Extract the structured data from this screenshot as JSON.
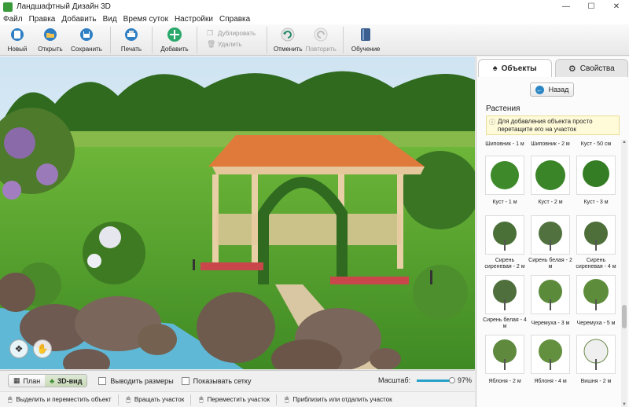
{
  "window": {
    "title": "Ландшафтный Дизайн 3D",
    "min": "—",
    "max": "☐",
    "close": "✕"
  },
  "menu": [
    "Файл",
    "Правка",
    "Добавить",
    "Вид",
    "Время суток",
    "Настройки",
    "Справка"
  ],
  "toolbar": {
    "new": "Новый",
    "open": "Открыть",
    "save": "Сохранить",
    "print": "Печать",
    "add": "Добавить",
    "duplicate": "Дублировать",
    "delete": "Удалить",
    "undo": "Отменить",
    "redo": "Повторить",
    "tutorial": "Обучение"
  },
  "panel": {
    "tab_objects": "Объекты",
    "tab_properties": "Свойства",
    "back": "Назад",
    "section": "Растения",
    "hint": "Для добавления объекта просто перетащите его на участок",
    "top_labels": [
      "Шиповник - 1 м",
      "Шиповник - 2 м",
      "Куст - 50 см"
    ],
    "items": [
      "Куст - 1 м",
      "Куст - 2 м",
      "Куст - 3 м",
      "Сирень сиреневая - 2 м",
      "Сирень белая - 2 м",
      "Сирень сиреневая - 4 м",
      "Сирень белая - 4 м",
      "Черемуха - 3 м",
      "Черемуха - 5 м",
      "Яблоня - 2 м",
      "Яблоня - 4 м",
      "Вишня - 2 м"
    ]
  },
  "bottom": {
    "plan": "План",
    "view3d": "3D-вид",
    "show_sizes": "Выводить размеры",
    "show_grid": "Показывать сетку",
    "zoom_label": "Масштаб:",
    "zoom_value": "97%",
    "zoom_level": 0.97
  },
  "status": [
    "Выделить и переместить объект",
    "Вращать участок",
    "Переместить участок",
    "Приблизить или отдалить участок"
  ],
  "colors": {
    "accent": "#27a0c8",
    "grass": "#4f9a2a",
    "roof": "#e07a3a",
    "water": "#5fb8d6"
  }
}
